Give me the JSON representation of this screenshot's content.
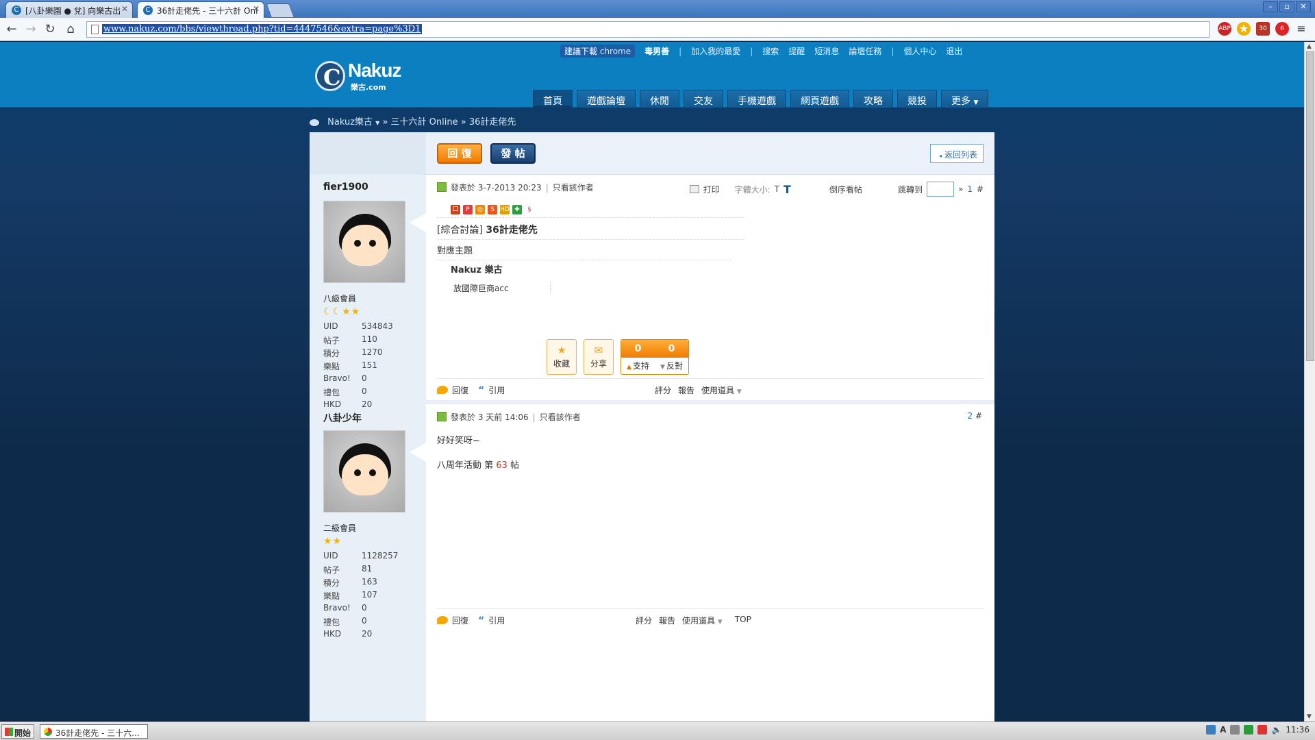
{
  "browser": {
    "tabs": [
      {
        "title": "[八卦樂園 ● 兌] 向樂古出",
        "active": false
      },
      {
        "title": "36計走佬先 - 三十六計 Onl",
        "active": true
      }
    ],
    "url": "www.nakuz.com/bbs/viewthread.php?tid=4447546&extra=page%3D1",
    "window_controls": [
      "–",
      "▫",
      "✕"
    ]
  },
  "site": {
    "topbar": {
      "suggest_download": "建議下載",
      "chrome": "chrome",
      "username": "毒男善",
      "links": [
        "加入我的最愛",
        "搜索",
        "提醒",
        "短消息",
        "論壇任務",
        "個人中心",
        "退出"
      ]
    },
    "logo": {
      "name": "Nakuz",
      "sub": "樂古.com"
    },
    "nav": [
      "首頁",
      "遊戲論壇",
      "休閒",
      "交友",
      "手機遊戲",
      "網頁遊戲",
      "攻略",
      "競投",
      "更多"
    ],
    "breadcrumb": {
      "root": "Nakuz樂古",
      "path": "» 三十六計 Online » 36計走佬先"
    }
  },
  "actions": {
    "reply": "回 復",
    "post": "發 帖",
    "back": "返回列表"
  },
  "posts": [
    {
      "author": "fier1900",
      "rank": "八級會員",
      "stars": "☾☾★★",
      "stats": [
        {
          "k": "UID",
          "v": "534843"
        },
        {
          "k": "帖子",
          "v": "110"
        },
        {
          "k": "積分",
          "v": "1270"
        },
        {
          "k": "樂點",
          "v": "151"
        },
        {
          "k": "Bravo!",
          "v": "0"
        },
        {
          "k": "禮包",
          "v": "0"
        },
        {
          "k": "HKD",
          "v": "20"
        }
      ],
      "posted": "發表於 3-7-2013 20:23",
      "only_author": "只看該作者",
      "tools": {
        "print": "打印",
        "font_size": "字體大小:",
        "small_t": "T",
        "big_t": "T",
        "reverse": "倒序看帖",
        "jump": "跳轉到",
        "next": "»"
      },
      "floor": "1",
      "title_tag": "[綜合討論]",
      "title": "36計走佬先",
      "text": "對應主題",
      "quote_head": "Nakuz 樂古",
      "quote_line": "放國際巨商acc",
      "fav": "收藏",
      "share": "分享",
      "support_count": "0",
      "oppose_count": "0",
      "support": "支持",
      "oppose": "反對",
      "footer": {
        "reply": "回復",
        "quote": "引用",
        "rate": "評分",
        "report": "報告",
        "tools": "使用道具"
      }
    },
    {
      "author": "八卦少年",
      "rank": "二級會員",
      "stars": "★★",
      "stats": [
        {
          "k": "UID",
          "v": "1128257"
        },
        {
          "k": "帖子",
          "v": "81"
        },
        {
          "k": "積分",
          "v": "163"
        },
        {
          "k": "樂點",
          "v": "107"
        },
        {
          "k": "Bravo!",
          "v": "0"
        },
        {
          "k": "禮包",
          "v": "0"
        },
        {
          "k": "HKD",
          "v": "20"
        }
      ],
      "posted": "發表於 3 天前 14:06",
      "only_author": "只看該作者",
      "floor": "2",
      "text": "好好笑呀~",
      "event_prefix": "八周年活動 第",
      "event_num": "63",
      "event_suffix": "帖",
      "footer": {
        "reply": "回復",
        "quote": "引用",
        "rate": "評分",
        "report": "報告",
        "tools": "使用道具",
        "top": "TOP"
      }
    }
  ],
  "taskbar": {
    "start": "開始",
    "item": "36計走佬先 - 三十六...",
    "clock": "11:36"
  }
}
